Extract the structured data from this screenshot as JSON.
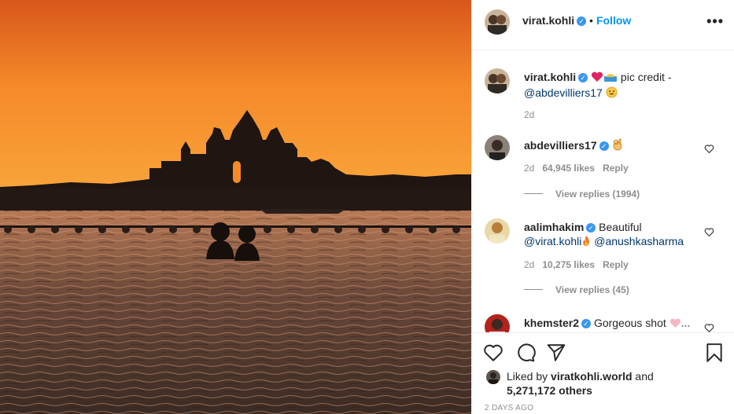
{
  "header": {
    "username": "virat.kohli",
    "verified_icon": "verified-badge-icon",
    "separator": "•",
    "follow_label": "Follow",
    "more_label": "•••"
  },
  "caption": {
    "username": "virat.kohli",
    "text": "pic credit -",
    "mention": "@abdevilliers17",
    "time": "2d"
  },
  "comments": [
    {
      "username": "abdevilliers17",
      "time": "2d",
      "likes": "64,945 likes",
      "reply_label": "Reply",
      "view_replies": "View replies (1994)"
    },
    {
      "username": "aalimhakim",
      "text": "Beautiful",
      "mention1": "@virat.kohli",
      "mention2": "@anushkasharma",
      "time": "2d",
      "likes": "10,275 likes",
      "reply_label": "Reply",
      "view_replies": "View replies (45)"
    },
    {
      "username": "khemster2",
      "text": "Gorgeous shot",
      "ellipsis": "..."
    }
  ],
  "liked_by": {
    "prefix": "Liked by",
    "user": "viratkohli.world",
    "and": "and",
    "others": "5,271,172 others"
  },
  "date": "2 DAYS AGO",
  "colors": {
    "accent": "#0095f6",
    "verified": "#3897f0",
    "sunset_top": "#d95a1a",
    "sunset_mid": "#f7932b"
  }
}
